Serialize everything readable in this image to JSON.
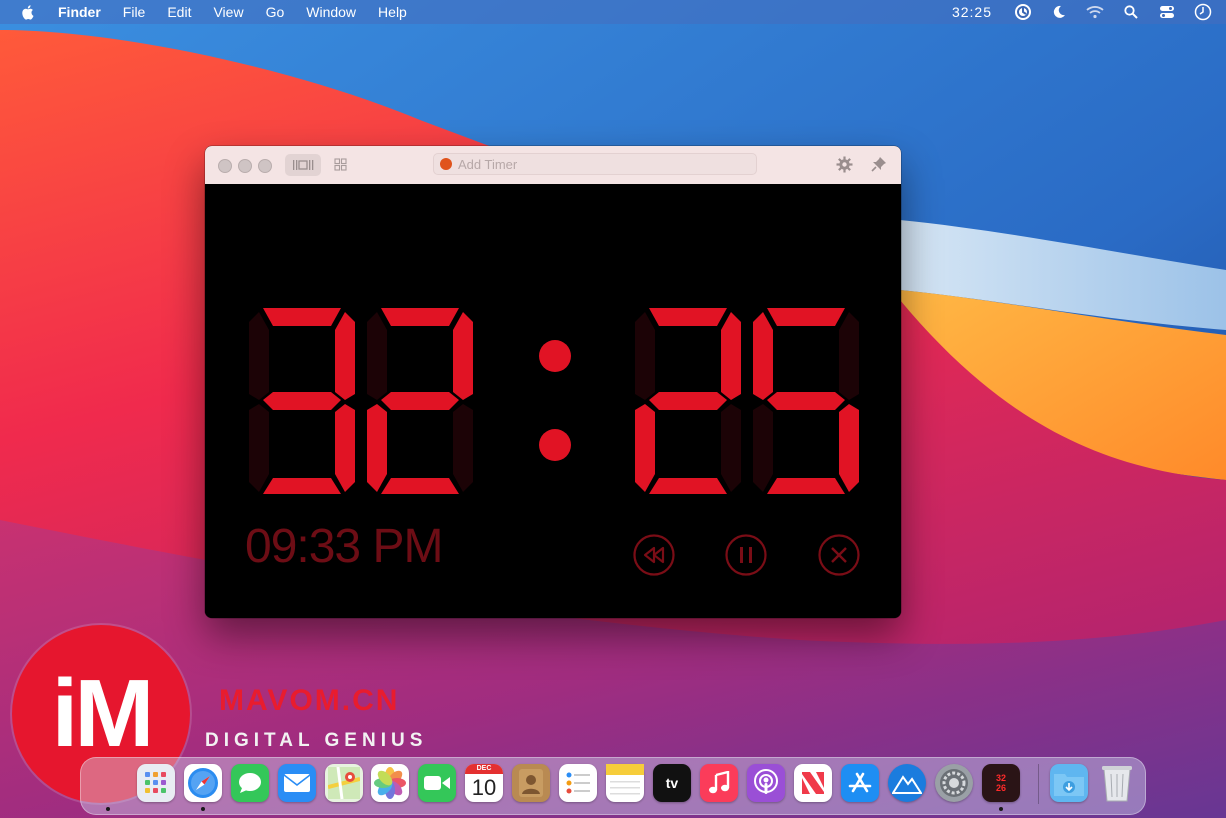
{
  "menubar": {
    "items": [
      "Finder",
      "File",
      "Edit",
      "View",
      "Go",
      "Window",
      "Help"
    ],
    "clock": "32:25"
  },
  "window": {
    "add_timer_placeholder": "Add Timer",
    "countdown_digits": [
      "3",
      "2",
      "2",
      "5"
    ],
    "time_of_day": "09:33 PM",
    "digit_color": "#e11324",
    "digit_off_color": "#1c0306"
  },
  "watermark": {
    "logo_text": "iM",
    "brand_name": "MAVOM.CN",
    "brand_sub": "DIGITAL GENIUS"
  },
  "dock": {
    "calendar_month": "DEC",
    "calendar_day": "10",
    "tv_label": "tv",
    "timer_icon_top": "32",
    "timer_icon_bottom": "26"
  }
}
